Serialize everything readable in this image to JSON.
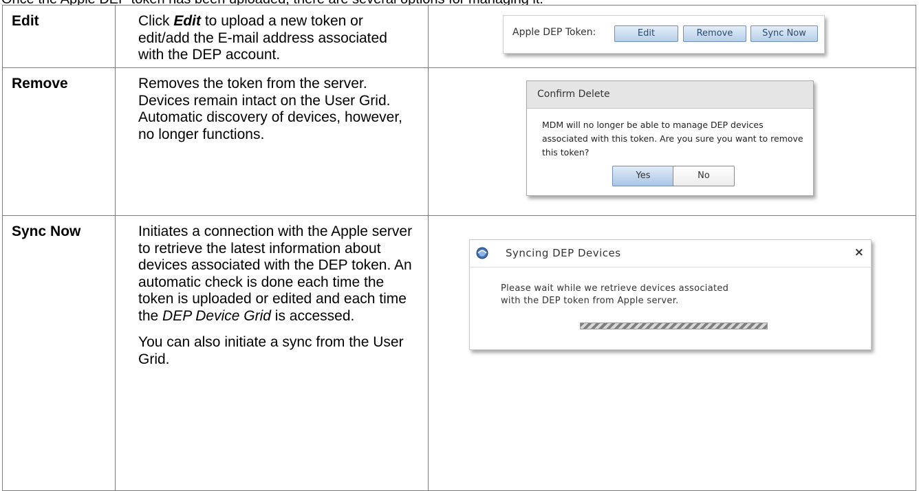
{
  "intro_cut": "Once the Apple DEP token has been uploaded, there are several options for managing it.",
  "rows": [
    {
      "term": "Edit",
      "desc_before": "Click ",
      "desc_em": "Edit",
      "desc_after": " to upload a new token or edit/add the E-mail address associated with the DEP account."
    },
    {
      "term": "Remove",
      "desc": "Removes the token from the server. Devices remain intact on the User Grid. Automatic discovery of devices, however, no longer functions."
    },
    {
      "term": "Sync Now",
      "desc_p1_a": "Initiates a connection with the Apple server to retrieve the latest information about devices associated with the DEP token. An automatic check is done each time the token is uploaded or edited and each time the ",
      "desc_p1_em": "DEP Device Grid",
      "desc_p1_b": " is accessed.",
      "desc_p2": "You can also initiate a sync from the User Grid."
    }
  ],
  "shots": {
    "token_bar": {
      "label": "Apple DEP Token:",
      "buttons": [
        "Edit",
        "Remove",
        "Sync Now"
      ]
    },
    "confirm_delete": {
      "title": "Confirm Delete",
      "message": "MDM will no longer be able to manage DEP devices associated with this token. Are you sure you want to remove this token?",
      "yes": "Yes",
      "no": "No"
    },
    "syncing": {
      "title": "Syncing DEP Devices",
      "close": "×",
      "message_line1": "Please wait while we retrieve devices associated",
      "message_line2": "with the DEP token from Apple server.",
      "icon": "sync-globe-icon"
    }
  }
}
